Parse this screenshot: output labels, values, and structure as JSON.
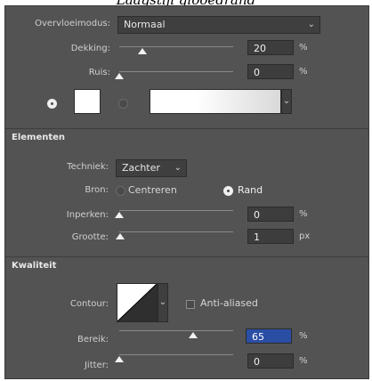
{
  "top_caption": "Laagstijl glooedrand",
  "structure": {
    "blend_mode_label": "Overvloeimodus:",
    "blend_mode_value": "Normaal",
    "opacity_label": "Dekking:",
    "opacity_value": "20",
    "opacity_unit": "%",
    "opacity_level": 0.2,
    "noise_label": "Ruis:",
    "noise_value": "0",
    "noise_unit": "%",
    "noise_level": 0,
    "color_swatch": "#ffffff",
    "gradient_colors": [
      "#ffffff",
      "#d6d6d6"
    ]
  },
  "elements": {
    "section_title": "Elementen",
    "technique_label": "Techniek:",
    "technique_value": "Zachter",
    "source_label": "Bron:",
    "source_center_label": "Centreren",
    "source_edge_label": "Rand",
    "choke_label": "Inperken:",
    "choke_value": "0",
    "choke_unit": "%",
    "choke_level": 0,
    "size_label": "Grootte:",
    "size_value": "1",
    "size_unit": "px",
    "size_level": 0.005
  },
  "quality": {
    "section_title": "Kwaliteit",
    "contour_label": "Contour:",
    "anti_aliased_label": "Anti-aliased",
    "anti_aliased_checked": false,
    "range_label": "Bereik:",
    "range_value": "65",
    "range_unit": "%",
    "range_level": 0.65,
    "jitter_label": "Jitter:",
    "jitter_value": "0",
    "jitter_unit": "%",
    "jitter_level": 0
  },
  "colors": {
    "panel_bg": "#535353",
    "field_bg": "#3d3d3d",
    "active_field": "#2b4ea5"
  }
}
